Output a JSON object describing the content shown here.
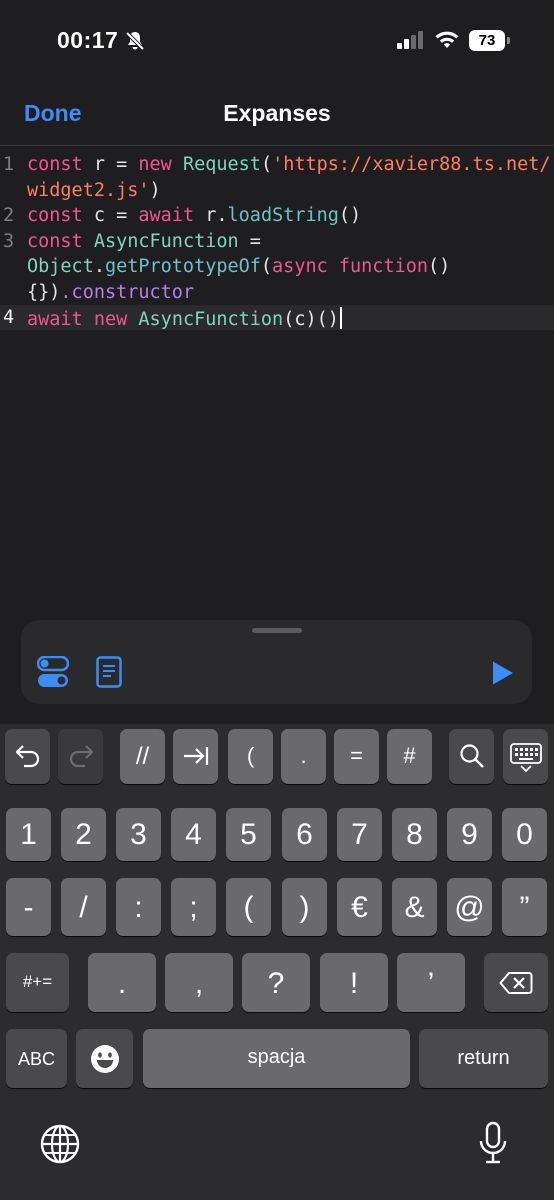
{
  "status_bar": {
    "time": "00:17",
    "battery": "73"
  },
  "nav": {
    "done_label": "Done",
    "title": "Expanses"
  },
  "editor": {
    "line_numbers": [
      "1",
      "2",
      "3",
      "4"
    ],
    "lines": {
      "l1a_kw": "const",
      "l1a_rest": " r = ",
      "l1a_kw2": "new",
      "l1a_cls": " Request",
      "l1a_open": "(",
      "l1a_str": "'https://xavier88.ts.net/",
      "l1b_str": "widget2.js'",
      "l1b_close": ")",
      "l2_kw": "const",
      "l2_rest": " c = ",
      "l2_kw2": "await",
      "l2_obj": " r.",
      "l2_fn": "loadString",
      "l2_close": "()",
      "l3a_kw": "const",
      "l3a_cls": " AsyncFunction",
      "l3a_rest": " =",
      "l3b_cls": "Object",
      "l3b_dot": ".",
      "l3b_fn": "getPrototypeOf",
      "l3b_open": "(",
      "l3b_kw": "async",
      "l3b_kw2": " function",
      "l3b_close": "()",
      "l3c_brace": "{})",
      "l3c_prop": ".constructor",
      "l4_kw": "await",
      "l4_kw2": " new",
      "l4_cls": " AsyncFunction",
      "l4_rest": "(c)()"
    }
  },
  "accessory": {
    "icons": [
      "toggle-icon",
      "document-icon",
      "play-icon"
    ],
    "accent": "#3a8ef6"
  },
  "keyboard": {
    "toolbar": [
      "undo-icon",
      "redo-icon",
      "//",
      "tab-icon",
      "(",
      ".",
      "=",
      "#",
      "search-icon",
      "keyboard-dismiss-icon"
    ],
    "row_numbers": [
      "1",
      "2",
      "3",
      "4",
      "5",
      "6",
      "7",
      "8",
      "9",
      "0"
    ],
    "row_symbols": [
      "-",
      "/",
      ":",
      ";",
      "(",
      ")",
      "€",
      "&",
      "@",
      "”"
    ],
    "row_punct": {
      "more": "#+=",
      "keys": [
        ".",
        ",",
        "?",
        "!",
        "’"
      ]
    },
    "bottom": {
      "abc": "ABC",
      "space": "spacja",
      "return": "return"
    }
  }
}
